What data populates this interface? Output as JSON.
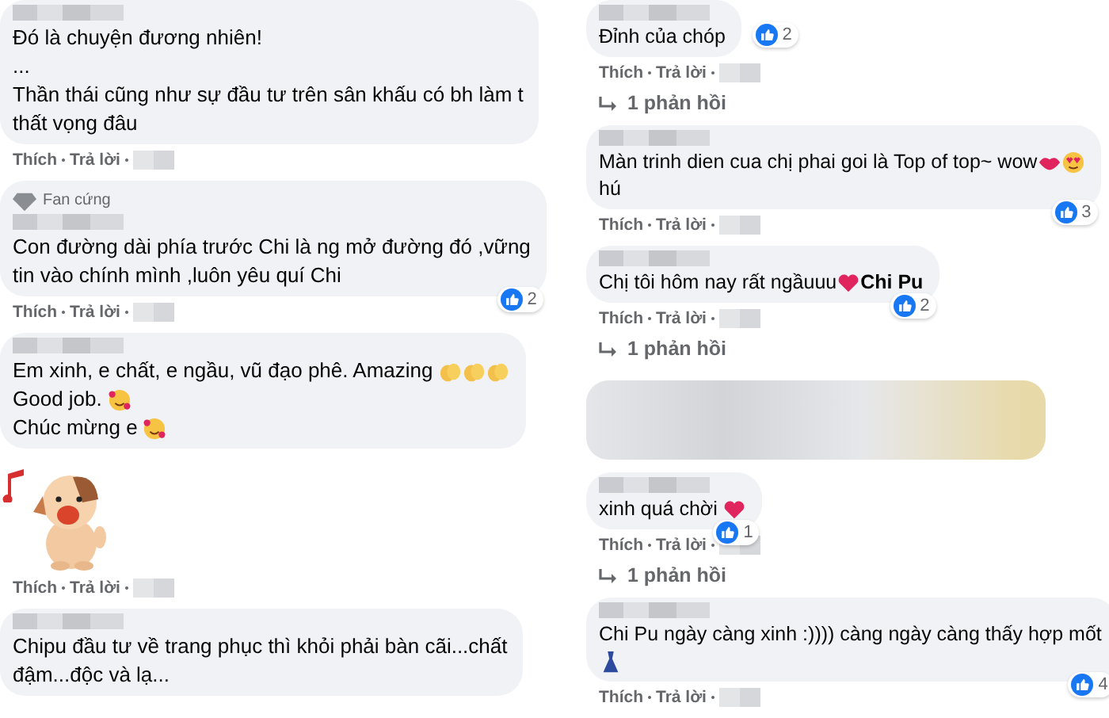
{
  "columns": [
    {
      "comments": [
        {
          "kind": "text",
          "lines": [
            [
              {
                "kind": "text",
                "text": "Đó là chuyện đương nhiên!"
              }
            ],
            [
              {
                "kind": "text",
                "text": "..."
              }
            ],
            [
              {
                "kind": "text",
                "text": "Thần thái cũng như sự đầu tư trên sân khấu có bh làm t"
              }
            ],
            [
              {
                "kind": "text",
                "text": "thất vọng đâu"
              }
            ]
          ],
          "actions": [
            "Thích",
            "Trả lời"
          ]
        },
        {
          "kind": "text",
          "badge": "Fan cứng",
          "lines": [
            [
              {
                "kind": "text",
                "text": "Con đường dài phía trước Chi là ng mở đường đó ,vững"
              }
            ],
            [
              {
                "kind": "text",
                "text": "tin vào chính mình ,luôn yêu quí Chi"
              }
            ]
          ],
          "likes": "2",
          "actions": [
            "Thích",
            "Trả lời"
          ]
        },
        {
          "kind": "text",
          "lines": [
            [
              {
                "kind": "text",
                "text": "Em xinh, e chất, e ngầu, vũ đạo phê. Amazing "
              },
              {
                "kind": "clap"
              },
              {
                "kind": "clap"
              },
              {
                "kind": "clap"
              }
            ],
            [
              {
                "kind": "text",
                "text": "Good job. "
              },
              {
                "kind": "smile-hearts"
              }
            ],
            [
              {
                "kind": "text",
                "text": "Chúc mừng e "
              },
              {
                "kind": "smile-hearts"
              }
            ]
          ]
        },
        {
          "kind": "sticker",
          "actions": [
            "Thích",
            "Trả lời"
          ]
        },
        {
          "kind": "text",
          "lines": [
            [
              {
                "kind": "text",
                "text": "Chipu đầu tư về trang phục thì khỏi phải bàn cãi...chất"
              }
            ],
            [
              {
                "kind": "text",
                "text": "đậm...độc và lạ..."
              }
            ]
          ]
        }
      ]
    },
    {
      "comments": [
        {
          "kind": "text",
          "lines": [
            [
              {
                "kind": "text",
                "text": "Đỉnh của chóp"
              }
            ]
          ],
          "likes": "2",
          "actions": [
            "Thích",
            "Trả lời"
          ],
          "replies": "1 phản hồi"
        },
        {
          "kind": "text",
          "lines": [
            [
              {
                "kind": "text",
                "text": "Màn trinh dien cua chị phai goi là Top of top~ wow"
              },
              {
                "kind": "lips"
              },
              {
                "kind": "heart-eyes"
              }
            ],
            [
              {
                "kind": "text",
                "text": "hú"
              }
            ]
          ],
          "likes": "3",
          "actions": [
            "Thích",
            "Trả lời"
          ]
        },
        {
          "kind": "text",
          "lines": [
            [
              {
                "kind": "text",
                "text": "Chị tôi hôm nay rất ngầuuu"
              },
              {
                "kind": "heart"
              },
              {
                "kind": "mention",
                "text": "Chi Pu"
              }
            ]
          ],
          "likes": "2",
          "actions": [
            "Thích",
            "Trả lời"
          ],
          "replies": "1 phản hồi"
        },
        {
          "kind": "blurred"
        },
        {
          "kind": "text",
          "lines": [
            [
              {
                "kind": "text",
                "text": "xinh quá chời "
              },
              {
                "kind": "heart"
              }
            ]
          ],
          "likes": "1",
          "actions": [
            "Thích",
            "Trả lời"
          ],
          "replies": "1 phản hồi"
        },
        {
          "kind": "text",
          "lines": [
            [
              {
                "kind": "text",
                "text": "Chi Pu ngày càng xinh :)))) càng ngày càng thấy hợp mốt"
              }
            ],
            [
              {
                "kind": "dress"
              }
            ]
          ],
          "likes": "4",
          "actions": [
            "Thích",
            "Trả lời"
          ]
        }
      ]
    }
  ]
}
